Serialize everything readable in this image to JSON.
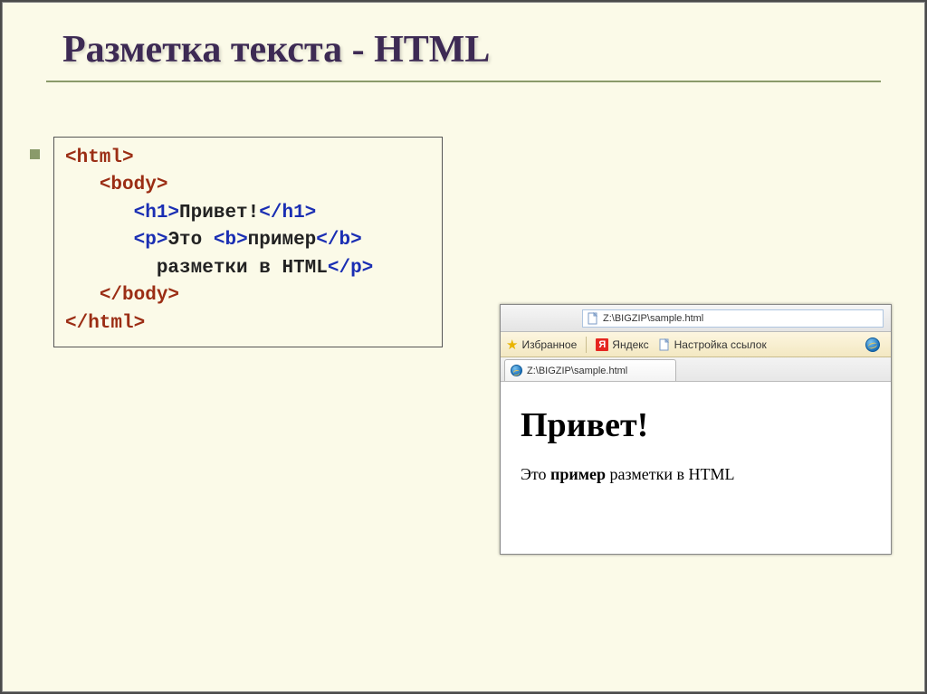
{
  "slide": {
    "title": "Разметка текста - HTML"
  },
  "code": {
    "line1_open": "<html>",
    "line2_open": "<body>",
    "line3_h1_open": "<h1>",
    "line3_text": "Привет!",
    "line3_h1_close": "</h1>",
    "line4_p_open": "<p>",
    "line4_text1": "Это ",
    "line4_b_open": "<b>",
    "line4_text2": "пример",
    "line4_b_close": "</b>",
    "line5_text": "разметки в HTML",
    "line5_p_close": "</p>",
    "line6_close": "</body>",
    "line7_close": "</html>"
  },
  "browser": {
    "address": "Z:\\BIGZIP\\sample.html",
    "favorites_label": "Избранное",
    "yandex_label": "Яндекс",
    "settings_link": "Настройка ссылок",
    "tab_title": "Z:\\BIGZIP\\sample.html",
    "page": {
      "heading": "Привет!",
      "para_a": "Это ",
      "para_b": "пример",
      "para_c": " разметки в HTML"
    }
  }
}
